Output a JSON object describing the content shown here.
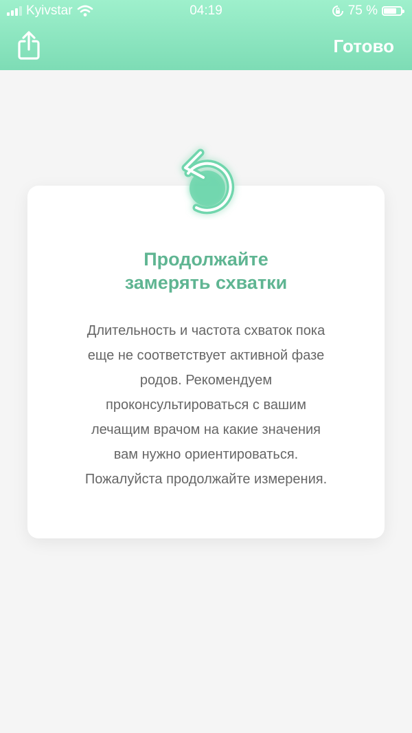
{
  "status_bar": {
    "carrier": "Kyivstar",
    "time": "04:19",
    "battery_text": "75 %",
    "battery_level": 0.75
  },
  "nav": {
    "share_icon": "share-icon",
    "done_label": "Готово"
  },
  "card": {
    "icon": "undo-arrow-icon",
    "title": "Продолжайте\nзамерять схватки",
    "body": "Длительность и частота схваток пока\nеще не соответствует активной фазе\nродов. Рекомендуем\nпроконсультироваться с вашим\nлечащим врачом на какие значения\nвам нужно ориентироваться.\nПожалуйста продолжайте измерения."
  },
  "colors": {
    "header_top": "#9ef0cc",
    "header_bottom": "#7ddcb5",
    "accent": "#5fb592",
    "icon": "#6fd6ad",
    "background": "#f5f5f5"
  }
}
